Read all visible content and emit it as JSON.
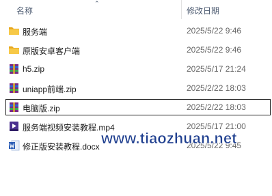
{
  "header": {
    "name_label": "名称",
    "date_label": "修改日期",
    "sort_icon": "chevron-up-icon"
  },
  "files": [
    {
      "name": "服务端",
      "date": "2025/5/22 9:46",
      "type": "folder",
      "icon": "folder-icon",
      "selected": false
    },
    {
      "name": "原版安卓客户端",
      "date": "2025/5/22 9:46",
      "type": "folder",
      "icon": "folder-icon",
      "selected": false
    },
    {
      "name": "h5.zip",
      "date": "2025/5/17 21:24",
      "type": "archive",
      "icon": "winrar-archive-icon",
      "selected": false
    },
    {
      "name": "uniapp前端.zip",
      "date": "2025/2/22 18:03",
      "type": "archive",
      "icon": "winrar-archive-icon",
      "selected": false
    },
    {
      "name": "电脑版.zip",
      "date": "2025/2/22 18:03",
      "type": "archive",
      "icon": "winrar-archive-icon",
      "selected": true
    },
    {
      "name": "服务端视频安装教程.mp4",
      "date": "2025/5/17 21:00",
      "type": "video",
      "icon": "mp4-video-icon",
      "selected": false
    },
    {
      "name": "修正版安装教程.docx",
      "date": "2025/5/22 9:45",
      "type": "document",
      "icon": "word-document-icon",
      "selected": false
    }
  ],
  "watermark": "www.tiaozhuan.net",
  "colors": {
    "folder": "#f5c342",
    "archive_stripe_1": "#8a2b8e",
    "archive_stripe_2": "#2a6bd1",
    "video": "#4a2f8f",
    "word": "#2b5db6",
    "watermark": "#1f3f8f"
  }
}
